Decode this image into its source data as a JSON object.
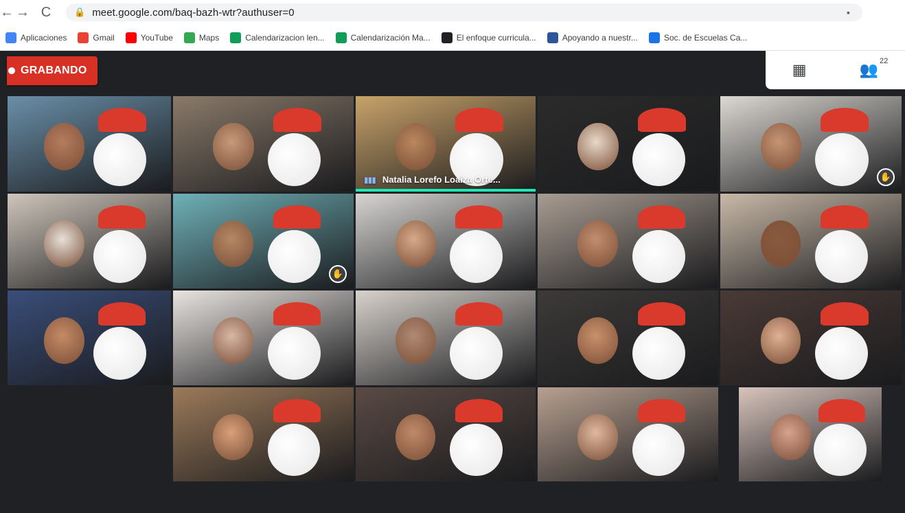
{
  "browser": {
    "nav": {
      "back": "←",
      "forward": "→",
      "reload": "C"
    },
    "url": "meet.google.com/baq-bazh-wtr?authuser=0",
    "bookmarks": [
      {
        "label": "Aplicaciones",
        "icon": "apps-icon",
        "color": "#4285f4"
      },
      {
        "label": "Gmail",
        "icon": "gmail-icon",
        "color": "#ea4335"
      },
      {
        "label": "YouTube",
        "icon": "youtube-icon",
        "color": "#ff0000"
      },
      {
        "label": "Maps",
        "icon": "maps-icon",
        "color": "#34a853"
      },
      {
        "label": "Calendarizacion len...",
        "icon": "sheets-icon",
        "color": "#0f9d58"
      },
      {
        "label": "Calendarización Ma...",
        "icon": "sheets-icon",
        "color": "#0f9d58"
      },
      {
        "label": "El enfoque curricula...",
        "icon": "doc-icon",
        "color": "#202124"
      },
      {
        "label": "Apoyando a nuestr...",
        "icon": "word-icon",
        "color": "#2b579a"
      },
      {
        "label": "Soc. de Escuelas Ca...",
        "icon": "site-icon",
        "color": "#1a73e8"
      }
    ]
  },
  "meet": {
    "recording_label": "GRABANDO",
    "participant_count": "22",
    "speaker_name": "Natalia Lorefo Loaiza Orte..."
  }
}
